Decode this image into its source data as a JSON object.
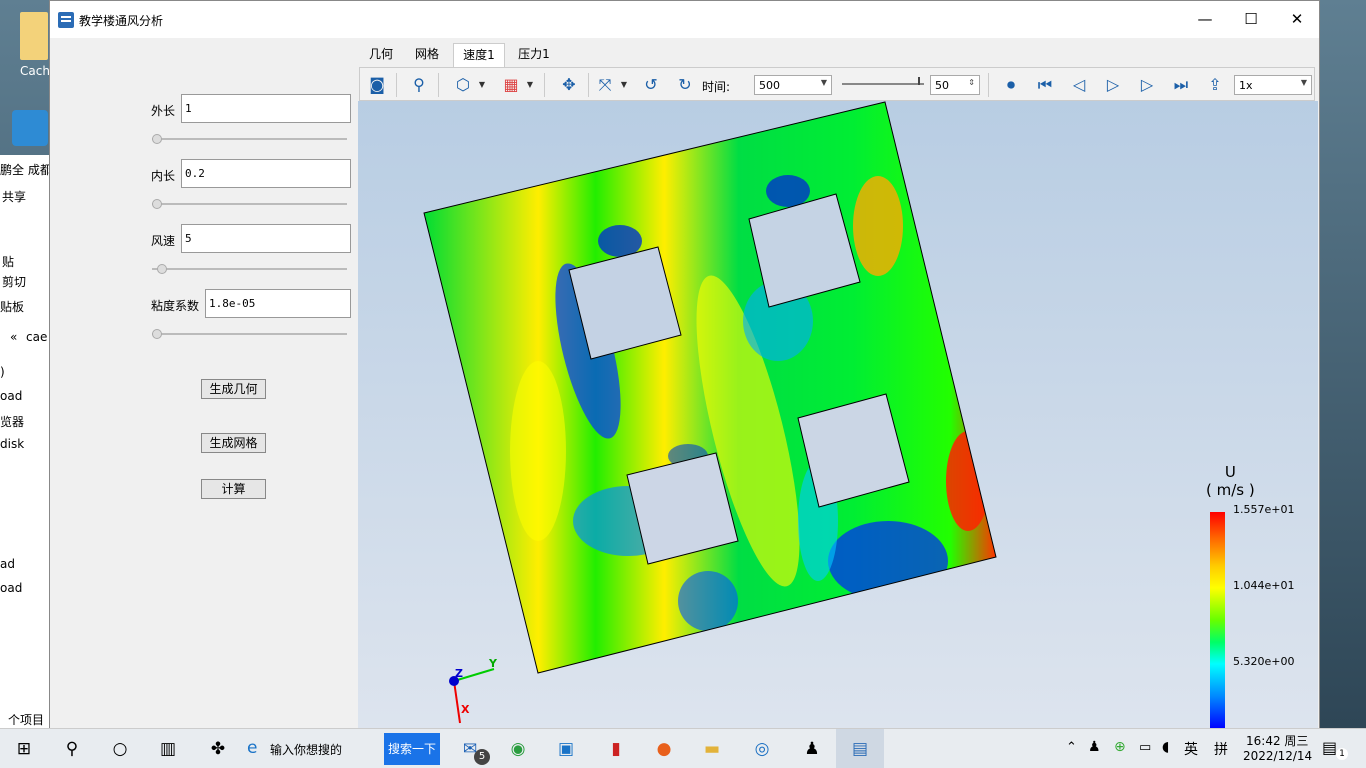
{
  "desktop": {
    "icon_label": "Cach"
  },
  "explorer": {
    "items": [
      "鹏全 成都",
      "共享",
      "贴",
      "剪切",
      "贴板",
      "«",
      "cae",
      ")",
      "oad",
      "览器",
      "disk",
      "ad",
      "oad",
      "个项目"
    ]
  },
  "window": {
    "title": "教学楼通风分析",
    "controls": {
      "minimize": "—",
      "maximize": "☐",
      "close": "✕"
    }
  },
  "params": [
    {
      "label": "外长",
      "value": "1"
    },
    {
      "label": "内长",
      "value": "0.2"
    },
    {
      "label": "风速",
      "value": "5"
    },
    {
      "label": "粘度系数",
      "value": "1.8e-05"
    }
  ],
  "buttons": {
    "gen_geometry": "生成几何",
    "gen_mesh": "生成网格",
    "compute": "计算"
  },
  "tabs": [
    "几何",
    "网格",
    "速度1",
    "压力1"
  ],
  "active_tab": "速度1",
  "toolbar": {
    "time_label": "时间:",
    "time_value": "500",
    "frame_value": "50",
    "speed_value": "1x",
    "icons": [
      "camera-icon",
      "zoom-icon",
      "display-mode-icon",
      "colormap-icon",
      "fit-view-icon",
      "axes-icon",
      "rotate-left-icon",
      "rotate-right-icon",
      "record-icon",
      "first-frame-icon",
      "prev-frame-icon",
      "play-icon",
      "next-frame-icon",
      "last-frame-icon",
      "export-icon"
    ]
  },
  "legend": {
    "field": "U",
    "unit": "( m/s )",
    "max": "1.557e+01",
    "mid": "1.044e+01",
    "low": "5.320e+00"
  },
  "axes": {
    "z": "Z",
    "y": "Y",
    "x": "X"
  },
  "taskbar": {
    "search_placeholder": "输入你想搜的",
    "search_button": "搜索一下",
    "mail_badge": "5",
    "ime_lang": "英",
    "ime_mode": "拼",
    "time": "16:42 周三",
    "date": "2022/12/14",
    "notification_count": "1"
  },
  "colors": {
    "accent": "#2b6cb6",
    "high": "#ff0000",
    "low": "#0000ff"
  }
}
